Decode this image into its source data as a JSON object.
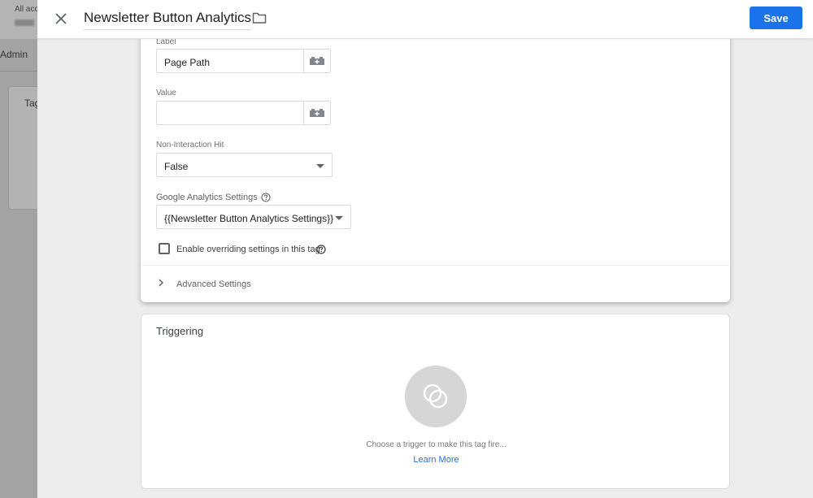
{
  "background": {
    "account_text": "All acc",
    "admin_tab": "Admin",
    "tags_card_label": "Tag"
  },
  "header": {
    "title": "Newsletter Button Analytics",
    "save_label": "Save"
  },
  "config": {
    "label_field": {
      "label": "Label",
      "value": "Page Path"
    },
    "value_field": {
      "label": "Value",
      "value": ""
    },
    "non_interaction": {
      "label": "Non-Interaction Hit",
      "selected": "False"
    },
    "ga_settings": {
      "label": "Google Analytics Settings",
      "selected": "{{Newsletter Button Analytics Settings}}"
    },
    "override_checkbox": {
      "label": "Enable overriding settings in this tag",
      "checked": false
    },
    "advanced": {
      "label": "Advanced Settings"
    }
  },
  "triggering": {
    "title": "Triggering",
    "hint": "Choose a trigger to make this tag fire...",
    "learn_more": "Learn More"
  },
  "colors": {
    "accent": "#1a73e8",
    "overlay": "#a3a3a3"
  },
  "icons": {
    "close": "close-icon",
    "folder": "folder-icon",
    "variable": "variable-brick-icon",
    "help": "help-circle-icon",
    "caret": "caret-down-icon",
    "chevron": "chevron-right-icon",
    "trigger": "trigger-circles-icon"
  }
}
